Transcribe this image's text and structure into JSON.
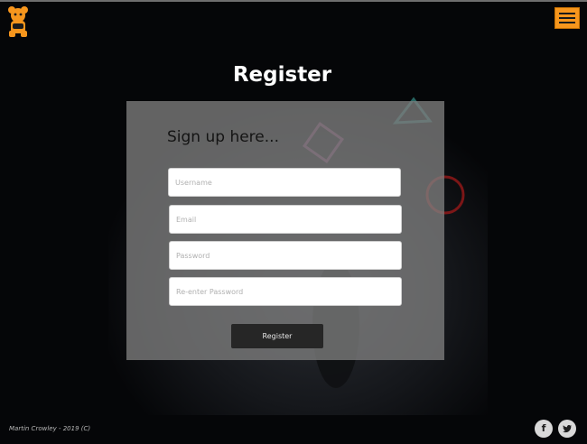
{
  "header": {
    "logo_icon": "teddy-bear-gamer-icon",
    "menu_icon": "hamburger-menu-icon",
    "accent_color": "#f7961d"
  },
  "page": {
    "title": "Register"
  },
  "form": {
    "heading": "Sign up here...",
    "username_placeholder": "Username",
    "email_placeholder": "Email",
    "password_placeholder": "Password",
    "reenter_placeholder": "Re-enter Password",
    "submit_label": "Register"
  },
  "footer": {
    "copyright": "Martin Crowley - 2019 (C)",
    "social": [
      {
        "icon": "facebook-icon",
        "glyph": "f"
      },
      {
        "icon": "twitter-icon",
        "glyph": "🐦"
      }
    ]
  }
}
